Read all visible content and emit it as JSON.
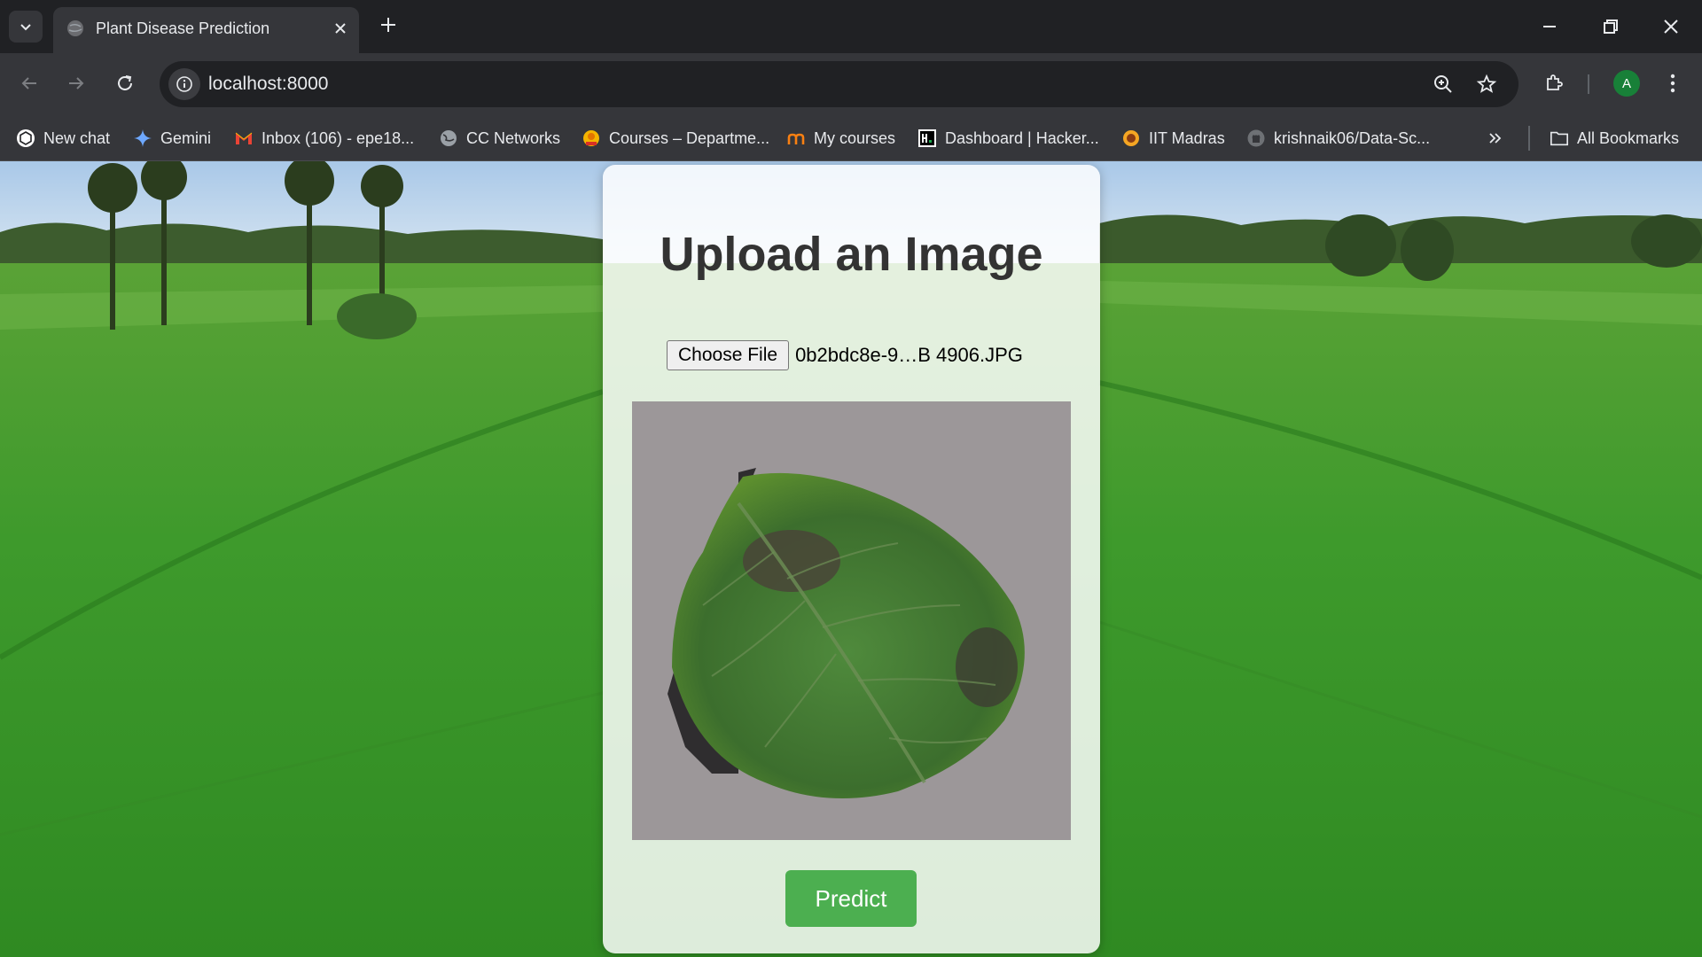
{
  "browser": {
    "tab": {
      "title": "Plant Disease Prediction"
    },
    "address_bar": {
      "url": "localhost:8000"
    },
    "profile_initial": "A",
    "bookmarks": [
      {
        "label": "New chat",
        "icon": "chatgpt-icon"
      },
      {
        "label": "Gemini",
        "icon": "gemini-icon"
      },
      {
        "label": "Inbox (106) - epe18...",
        "icon": "gmail-icon"
      },
      {
        "label": "CC Networks",
        "icon": "globe-icon"
      },
      {
        "label": "Courses – Departme...",
        "icon": "courses-icon"
      },
      {
        "label": "My courses",
        "icon": "moodle-icon"
      },
      {
        "label": "Dashboard | Hacker...",
        "icon": "hackerrank-icon"
      },
      {
        "label": "IIT Madras",
        "icon": "iitm-icon"
      },
      {
        "label": "krishnaik06/Data-Sc...",
        "icon": "github-icon"
      }
    ],
    "all_bookmarks_label": "All Bookmarks"
  },
  "page": {
    "heading": "Upload an Image",
    "choose_file_label": "Choose File",
    "file_name": "0b2bdc8e-9…B 4906.JPG",
    "predict_label": "Predict"
  },
  "colors": {
    "predict_button": "#4caf50",
    "heading_text": "#333333",
    "chrome_dark": "#202124",
    "chrome_toolbar": "#35363a"
  }
}
